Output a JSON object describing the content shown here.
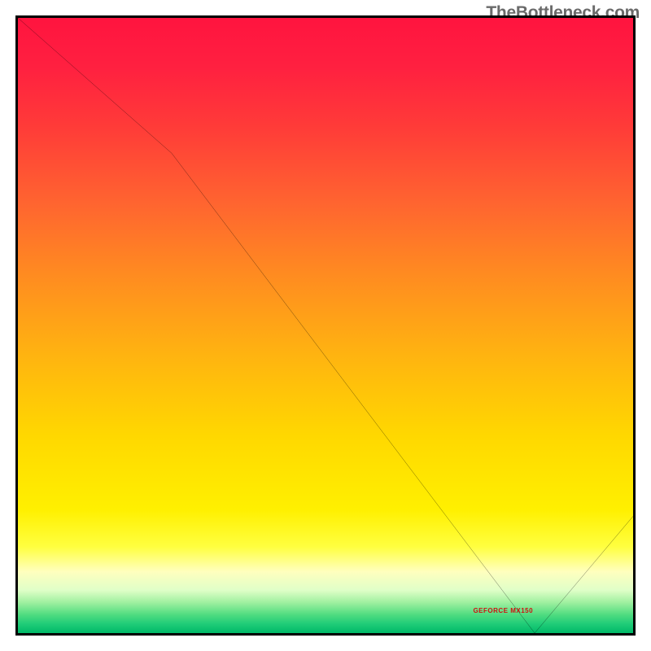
{
  "watermark": "TheBottleneck.com",
  "marker": {
    "text": "GEFORCE MX150",
    "left_pct": 74.0,
    "top_pct": 95.8
  },
  "chart_data": {
    "type": "line",
    "title": "",
    "xlabel": "",
    "ylabel": "",
    "x": [
      0,
      25,
      84,
      100
    ],
    "values": [
      100,
      78,
      0,
      19
    ],
    "xlim": [
      0,
      100
    ],
    "ylim": [
      0,
      100
    ],
    "background_gradient": {
      "direction": "vertical",
      "stops": [
        {
          "pos": 0.0,
          "color": "#ff143f"
        },
        {
          "pos": 0.08,
          "color": "#ff2040"
        },
        {
          "pos": 0.18,
          "color": "#ff3c38"
        },
        {
          "pos": 0.3,
          "color": "#ff6430"
        },
        {
          "pos": 0.42,
          "color": "#ff8c20"
        },
        {
          "pos": 0.55,
          "color": "#ffb410"
        },
        {
          "pos": 0.68,
          "color": "#ffd800"
        },
        {
          "pos": 0.8,
          "color": "#fff000"
        },
        {
          "pos": 0.86,
          "color": "#ffff40"
        },
        {
          "pos": 0.9,
          "color": "#ffffbe"
        },
        {
          "pos": 0.93,
          "color": "#e0ffc8"
        },
        {
          "pos": 0.95,
          "color": "#a0f0a0"
        },
        {
          "pos": 0.97,
          "color": "#50dc80"
        },
        {
          "pos": 0.985,
          "color": "#20cc78"
        },
        {
          "pos": 1.0,
          "color": "#00b968"
        }
      ]
    },
    "annotations": [
      {
        "text": "GEFORCE MX150",
        "x": 78,
        "y": 2
      }
    ]
  }
}
